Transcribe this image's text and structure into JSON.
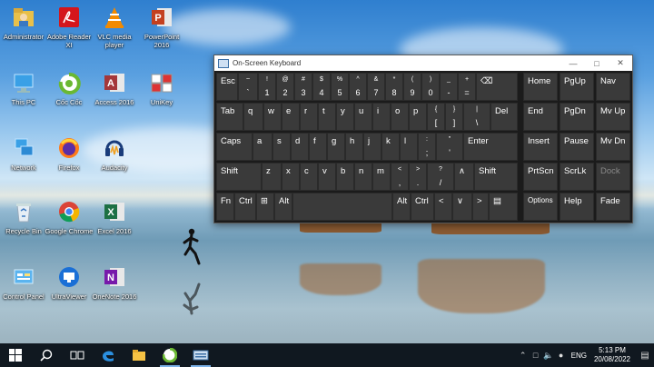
{
  "desktop": {
    "icons": [
      {
        "label": "Administrator",
        "icon": "user-folder-icon"
      },
      {
        "label": "Adobe Reader XI",
        "icon": "adobe-reader-icon"
      },
      {
        "label": "VLC media player",
        "icon": "vlc-icon"
      },
      {
        "label": "PowerPoint 2016",
        "icon": "powerpoint-icon"
      },
      {
        "label": "This PC",
        "icon": "computer-icon"
      },
      {
        "label": "Cốc Cốc",
        "icon": "coccoc-browser-icon"
      },
      {
        "label": "Access 2016",
        "icon": "access-icon"
      },
      {
        "label": "UniKey",
        "icon": "unikey-icon"
      },
      {
        "label": "Network",
        "icon": "network-icon"
      },
      {
        "label": "Firefox",
        "icon": "firefox-icon"
      },
      {
        "label": "Audacity",
        "icon": "audacity-icon"
      },
      {
        "label": "Recycle Bin",
        "icon": "recycle-bin-icon"
      },
      {
        "label": "Google Chrome",
        "icon": "chrome-icon"
      },
      {
        "label": "Excel 2016",
        "icon": "excel-icon"
      },
      {
        "label": "Control Panel",
        "icon": "control-panel-icon"
      },
      {
        "label": "UltraViewer",
        "icon": "ultraviewer-icon"
      },
      {
        "label": "OneNote 2016",
        "icon": "onenote-icon"
      }
    ]
  },
  "osk": {
    "title": "On-Screen Keyboard",
    "row1": [
      {
        "label": "Esc"
      },
      {
        "label": "~",
        "sub": "`"
      },
      {
        "label": "!",
        "sub": "1"
      },
      {
        "label": "@",
        "sub": "2"
      },
      {
        "label": "#",
        "sub": "3"
      },
      {
        "label": "$",
        "sub": "4"
      },
      {
        "label": "%",
        "sub": "5"
      },
      {
        "label": "^",
        "sub": "6"
      },
      {
        "label": "&",
        "sub": "7"
      },
      {
        "label": "*",
        "sub": "8"
      },
      {
        "label": "(",
        "sub": "9"
      },
      {
        "label": ")",
        "sub": "0"
      },
      {
        "label": "_",
        "sub": "-"
      },
      {
        "label": "+",
        "sub": "="
      },
      {
        "label": "⌫"
      }
    ],
    "row2": [
      {
        "label": "Tab"
      },
      {
        "label": "q"
      },
      {
        "label": "w"
      },
      {
        "label": "e"
      },
      {
        "label": "r"
      },
      {
        "label": "t"
      },
      {
        "label": "y"
      },
      {
        "label": "u"
      },
      {
        "label": "i"
      },
      {
        "label": "o"
      },
      {
        "label": "p"
      },
      {
        "label": "{",
        "sub": "["
      },
      {
        "label": "}",
        "sub": "]"
      },
      {
        "label": "|",
        "sub": "\\"
      },
      {
        "label": "Del"
      }
    ],
    "row3": [
      {
        "label": "Caps"
      },
      {
        "label": "a"
      },
      {
        "label": "s"
      },
      {
        "label": "d"
      },
      {
        "label": "f"
      },
      {
        "label": "g"
      },
      {
        "label": "h"
      },
      {
        "label": "j"
      },
      {
        "label": "k"
      },
      {
        "label": "l"
      },
      {
        "label": ":",
        "sub": ";"
      },
      {
        "label": "\"",
        "sub": "'"
      },
      {
        "label": "Enter"
      }
    ],
    "row4": [
      {
        "label": "Shift"
      },
      {
        "label": "z"
      },
      {
        "label": "x"
      },
      {
        "label": "c"
      },
      {
        "label": "v"
      },
      {
        "label": "b"
      },
      {
        "label": "n"
      },
      {
        "label": "m"
      },
      {
        "label": "<",
        "sub": ","
      },
      {
        "label": ">",
        "sub": "."
      },
      {
        "label": "?",
        "sub": "/"
      },
      {
        "label": "∧"
      },
      {
        "label": "Shift"
      }
    ],
    "row5": [
      {
        "label": "Fn"
      },
      {
        "label": "Ctrl"
      },
      {
        "label": "⊞"
      },
      {
        "label": "Alt"
      },
      {
        "label": ""
      },
      {
        "label": "Alt"
      },
      {
        "label": "Ctrl"
      },
      {
        "label": "<"
      },
      {
        "label": "∨"
      },
      {
        "label": ">"
      },
      {
        "label": "▤"
      }
    ],
    "side": [
      {
        "label": "Home"
      },
      {
        "label": "PgUp"
      },
      {
        "label": "Nav"
      },
      {
        "label": "End"
      },
      {
        "label": "PgDn"
      },
      {
        "label": "Mv Up"
      },
      {
        "label": "Insert"
      },
      {
        "label": "Pause"
      },
      {
        "label": "Mv Dn"
      },
      {
        "label": "PrtScn"
      },
      {
        "label": "ScrLk"
      },
      {
        "label": "Dock"
      },
      {
        "label": "Options"
      },
      {
        "label": "Help"
      },
      {
        "label": "Fade"
      }
    ]
  },
  "taskbar": {
    "items": [
      "start-icon",
      "search-icon",
      "task-view-icon",
      "edge-icon",
      "file-explorer-icon",
      "coccoc-taskbar-icon",
      "osk-taskbar-icon"
    ],
    "language": "ENG",
    "time": "5:13 PM",
    "date": "20/08/2022"
  }
}
